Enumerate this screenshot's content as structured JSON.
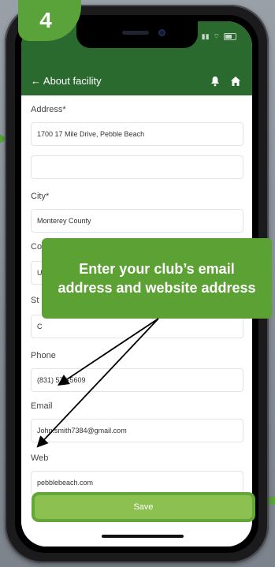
{
  "tutorial": {
    "step_number": "4",
    "callout_text": "Enter your club’s email address and website address"
  },
  "appbar": {
    "back_label": "← About facility",
    "bell_icon": "bell-icon",
    "home_icon": "home-icon",
    "color": "#2a6a2f"
  },
  "form": {
    "address_label": "Address*",
    "address_value": "1700 17 Mile Drive, Pebble Beach",
    "address2_value": "",
    "city_label": "City*",
    "city_value": "Monterey County",
    "country_label": "Country*",
    "country_value": "U",
    "state_label": "St",
    "state_value": "C",
    "phone_label": "Phone",
    "phone_value": "(831) 574-5609",
    "email_label": "Email",
    "email_value": "John.smith7384@gmail.com",
    "web_label": "Web",
    "web_value": "pebblebeach.com",
    "save_label": "Save"
  },
  "colors": {
    "accent_green": "#5aa23a",
    "save_button": "#8cc152"
  }
}
